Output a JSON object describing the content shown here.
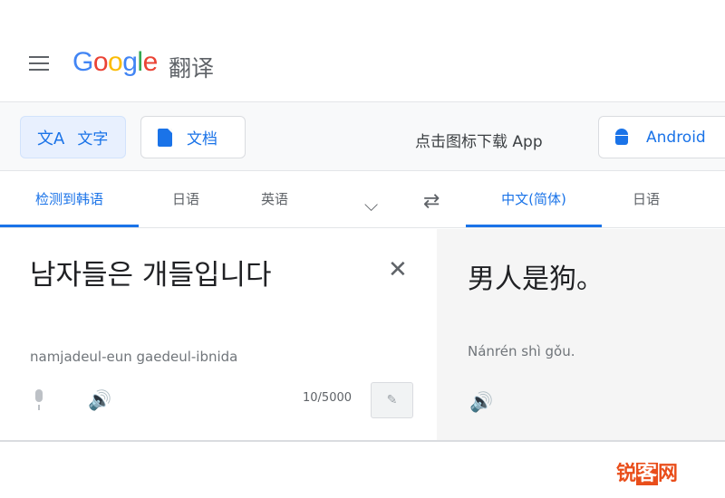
{
  "header": {
    "logo_text": "Google",
    "logo_sub": "翻译"
  },
  "toolbar": {
    "text_mode_label": "文字",
    "doc_mode_label": "文档",
    "app_download_text": "点击图标下载 App",
    "android_label": "Android"
  },
  "source_langs": [
    {
      "label": "检测到韩语",
      "active": true
    },
    {
      "label": "日语",
      "active": false
    },
    {
      "label": "英语",
      "active": false
    }
  ],
  "target_langs": [
    {
      "label": "中文(简体)",
      "active": true
    },
    {
      "label": "日语",
      "active": false
    }
  ],
  "source": {
    "text": "남자들은 개들입니다",
    "romanization": "namjadeul-eun gaedeul-ibnida",
    "char_count": "10/5000"
  },
  "target": {
    "text": "男人是狗。",
    "pinyin": "Nánrén shì gǒu."
  },
  "watermark": {
    "part1": "锐",
    "part2": "客",
    "part3": "网"
  },
  "colors": {
    "accent": "#1a73e8",
    "target_bg": "#f5f5f5",
    "watermark": "#e94e1b"
  }
}
